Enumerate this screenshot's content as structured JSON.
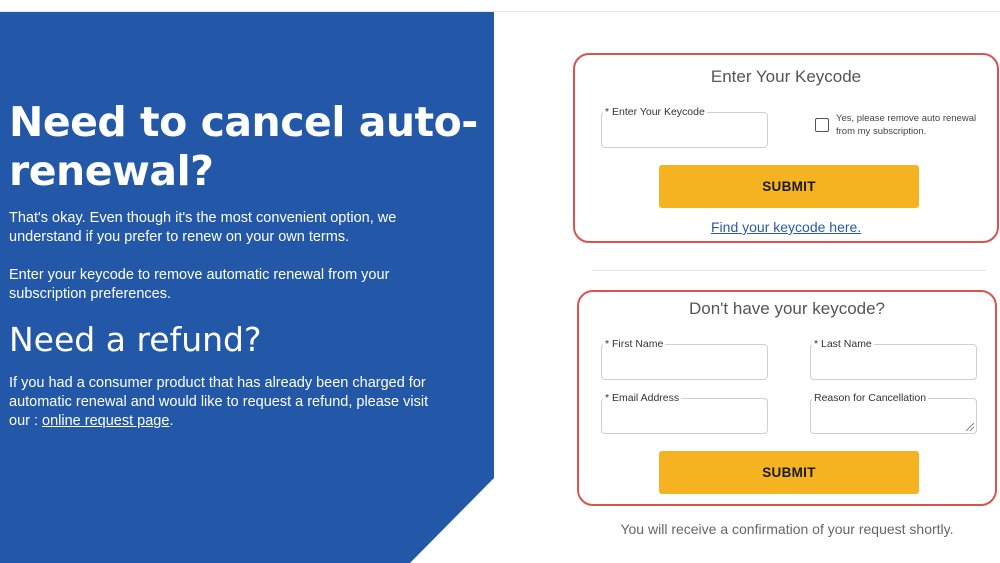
{
  "hero": {
    "heading": "Need to cancel auto-renewal?",
    "paragraph1": "That's okay. Even though it's the most convenient option, we understand if you prefer to renew on your own terms.",
    "paragraph2": "Enter your keycode to remove automatic renewal from your subscription preferences.",
    "refund_heading": "Need a refund?",
    "refund_text": "If you had a consumer product that has already been charged for automatic renewal and would like to request a refund, please visit our : ",
    "refund_link": "online request page",
    "refund_suffix": "."
  },
  "keycode_form": {
    "title": "Enter Your Keycode",
    "keycode_label": "* Enter Your Keycode",
    "keycode_value": "",
    "checkbox_label": "Yes, please remove auto renewal from my subscription.",
    "checkbox_checked": false,
    "submit_label": "SUBMIT",
    "find_link": "Find your keycode here."
  },
  "no_keycode_form": {
    "title": "Don't have your keycode?",
    "first_name_label": "* First Name",
    "last_name_label": "* Last Name",
    "email_label": "* Email Address",
    "reason_label": "Reason for Cancellation",
    "submit_label": "SUBMIT",
    "confirmation": "You will receive a confirmation of your request shortly."
  },
  "colors": {
    "hero_blue": "#2358a8",
    "submit_yellow": "#f5b321",
    "highlight_red": "#d9534f",
    "link_blue": "#2a5aa8"
  }
}
